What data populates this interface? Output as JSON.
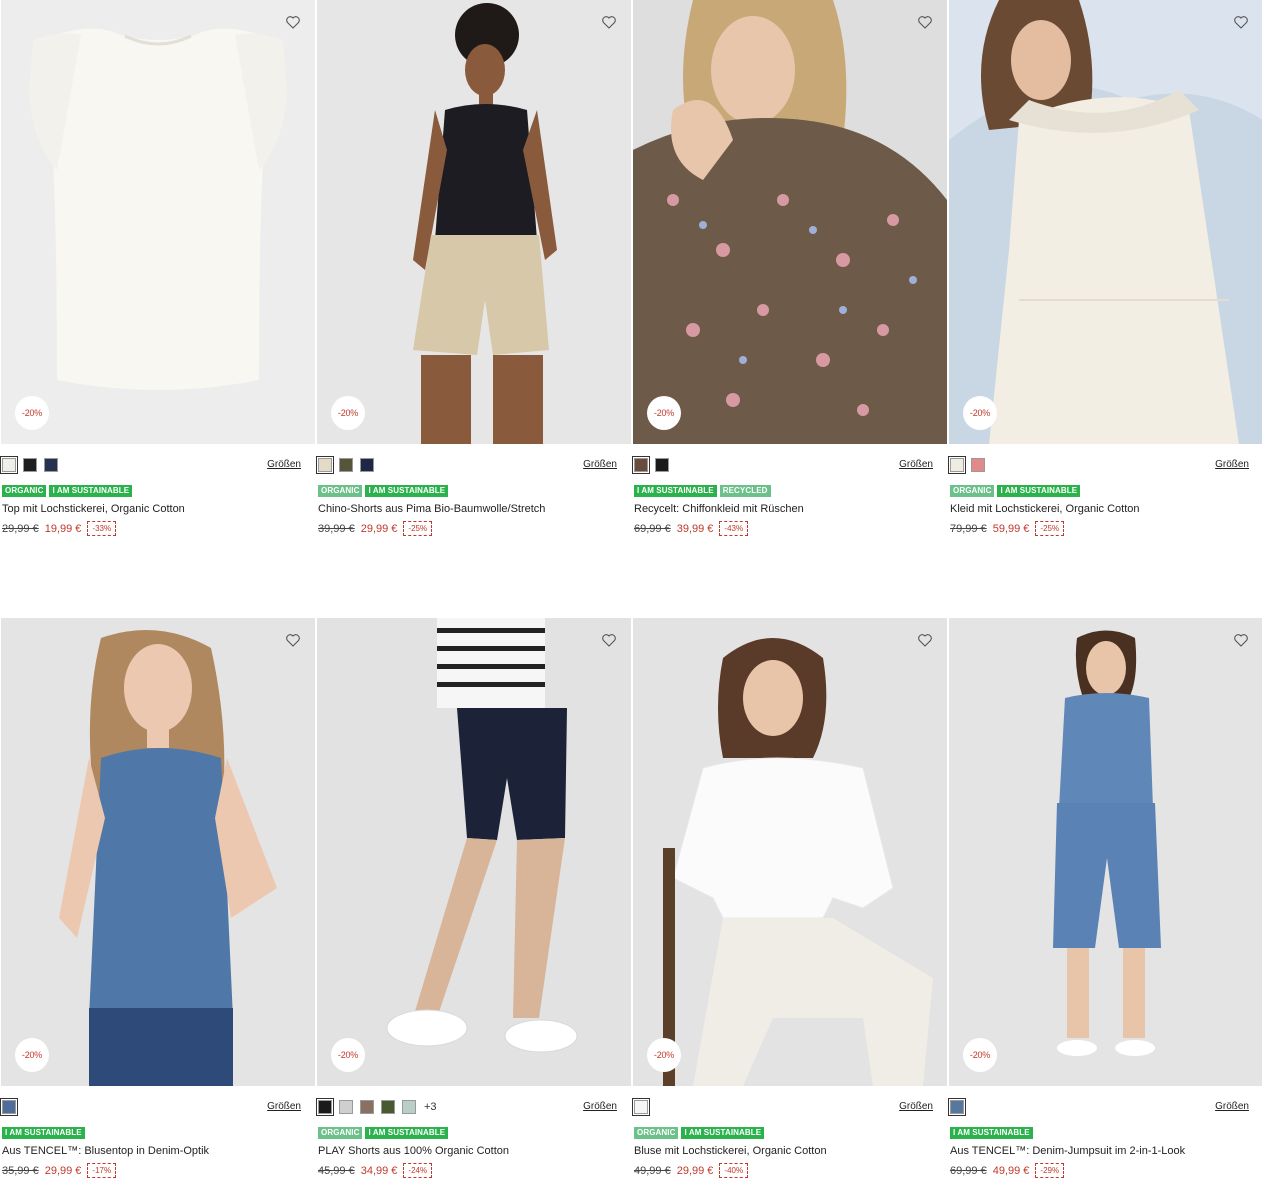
{
  "sizes_label": "Größen",
  "favorite_icon": "heart-icon",
  "colors": {
    "sale": "#c0392b",
    "badge_green": "#2bb24c",
    "badge_light_green": "#6cc08a"
  },
  "products": [
    {
      "title": "Top mit Lochstickerei, Organic Cotton",
      "old_price": "29,99 €",
      "new_price": "19,99 €",
      "percent": "-33%",
      "discount_badge": "-20%",
      "badges": [
        "ORGANIC",
        "I AM SUSTAINABLE"
      ],
      "swatches": [
        "#eeeeea",
        "#1e1e1e",
        "#26304f"
      ],
      "more_colors": ""
    },
    {
      "title": "Chino-Shorts aus Pima Bio-Baumwolle/Stretch",
      "old_price": "39,99 €",
      "new_price": "29,99 €",
      "percent": "-25%",
      "discount_badge": "-20%",
      "badges": [
        "ORGANIC",
        "I AM SUSTAINABLE"
      ],
      "swatches": [
        "#e4dac6",
        "#55553a",
        "#1e2748"
      ],
      "more_colors": ""
    },
    {
      "title": "Recycelt: Chiffonkleid mit Rüschen",
      "old_price": "69,99 €",
      "new_price": "39,99 €",
      "percent": "-43%",
      "discount_badge": "-20%",
      "badges": [
        "I AM SUSTAINABLE",
        "RECYCLED"
      ],
      "swatches": [
        "#6a4c3c",
        "#1a1a1a"
      ],
      "more_colors": ""
    },
    {
      "title": "Kleid mit Lochstickerei, Organic Cotton",
      "old_price": "79,99 €",
      "new_price": "59,99 €",
      "percent": "-25%",
      "discount_badge": "-20%",
      "badges": [
        "ORGANIC",
        "I AM SUSTAINABLE"
      ],
      "swatches": [
        "#efece2",
        "#e08a8a"
      ],
      "more_colors": ""
    },
    {
      "title": "Aus TENCEL™: Blusentop in Denim-Optik",
      "old_price": "35,99 €",
      "new_price": "29,99 €",
      "percent": "-17%",
      "discount_badge": "-20%",
      "badges": [
        "I AM SUSTAINABLE"
      ],
      "swatches": [
        "#4f6d9a"
      ],
      "more_colors": ""
    },
    {
      "title": "PLAY Shorts aus 100% Organic Cotton",
      "old_price": "45,99 €",
      "new_price": "34,99 €",
      "percent": "-24%",
      "discount_badge": "-20%",
      "badges": [
        "ORGANIC",
        "I AM SUSTAINABLE"
      ],
      "swatches": [
        "#1a1a1a",
        "#cfcfcf",
        "#8a7060",
        "#4a5a30",
        "#b8cfc8"
      ],
      "more_colors": "+3"
    },
    {
      "title": "Bluse mit Lochstickerei, Organic Cotton",
      "old_price": "49,99 €",
      "new_price": "29,99 €",
      "percent": "-40%",
      "discount_badge": "-20%",
      "badges": [
        "ORGANIC",
        "I AM SUSTAINABLE"
      ],
      "swatches": [
        "#f5f5f5"
      ],
      "more_colors": ""
    },
    {
      "title": "Aus TENCEL™: Denim-Jumpsuit im 2-in-1-Look",
      "old_price": "69,99 €",
      "new_price": "49,99 €",
      "percent": "-29%",
      "discount_badge": "-20%",
      "badges": [
        "I AM SUSTAINABLE"
      ],
      "swatches": [
        "#56779e"
      ],
      "more_colors": ""
    }
  ]
}
